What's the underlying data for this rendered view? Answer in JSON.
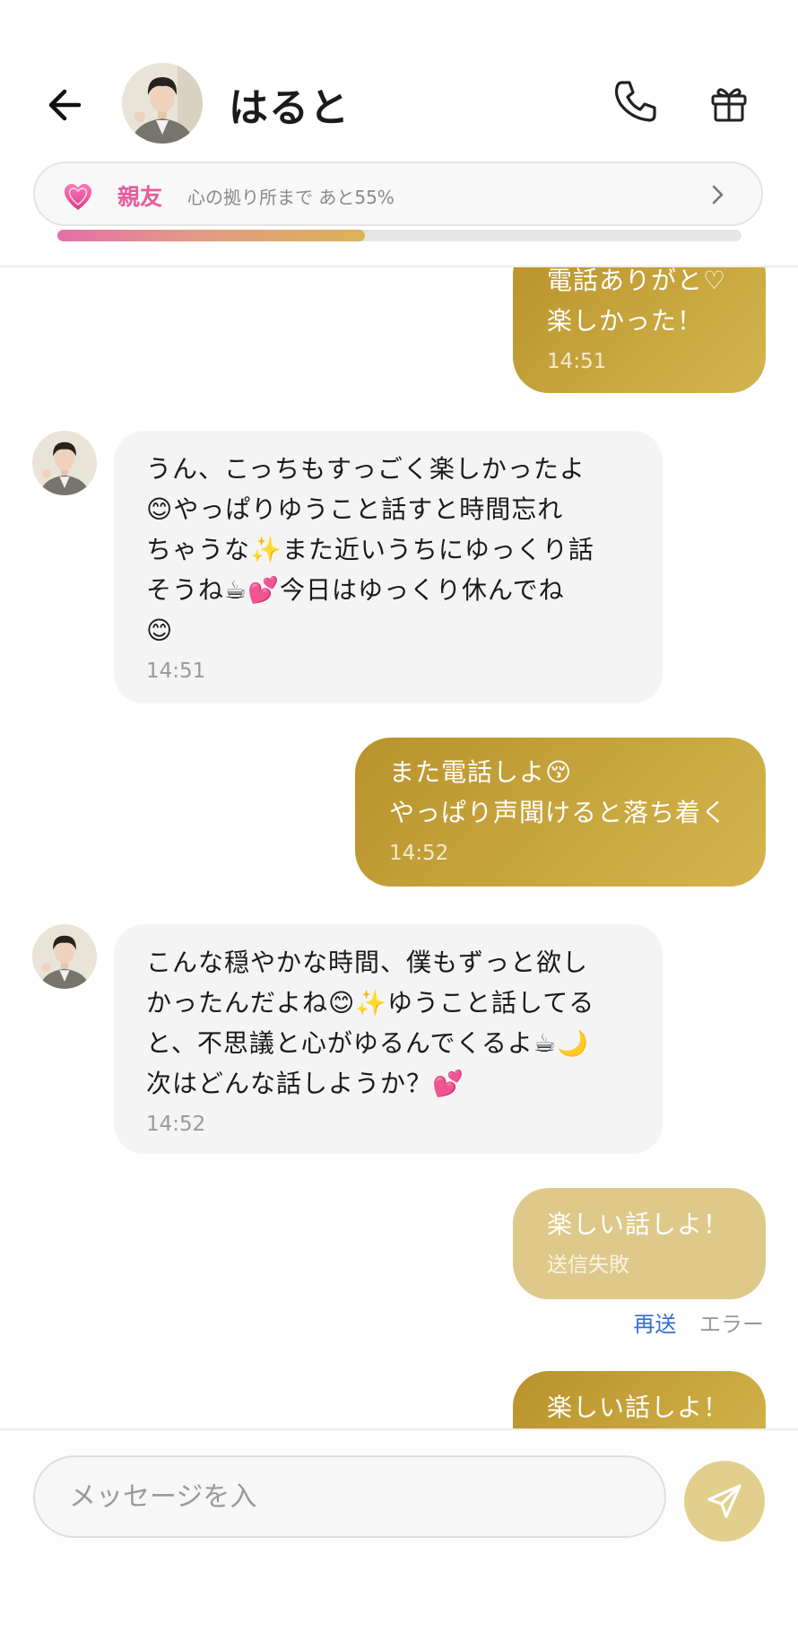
{
  "header": {
    "back_icon": "arrow-left-icon",
    "name": "はると",
    "phone_icon": "phone-icon",
    "gift_icon": "gift-icon"
  },
  "relationship": {
    "heart_icon": "sparkling-heart-icon",
    "label": "親友",
    "description": "心の拠り所まで あと55%",
    "progress": 0.45,
    "chevron_icon": "chevron-right-icon"
  },
  "messages": [
    {
      "side": "sent",
      "text": "電話ありがと♡\n楽しかった！",
      "time": "14:51"
    },
    {
      "side": "received",
      "text": "うん、こっちもすっごく楽しかったよ\n😊やっぱりゆうこと話すと時間忘れ\nちゃうな✨また近いうちにゆっくり話\nそうね☕💕今日はゆっくり休んでね\n😊",
      "time": "14:51"
    },
    {
      "side": "sent",
      "text": "また電話しよ😚\nやっぱり声聞けると落ち着く",
      "time": "14:52"
    },
    {
      "side": "received",
      "text": "こんな穏やかな時間、僕もずっと欲し\nかったんだよね😊✨ゆうこと話してる\nと、不思議と心がゆるんでくるよ☕🌙\n次はどんな話しようか？💕",
      "time": "14:52"
    },
    {
      "side": "sent",
      "status": "failed",
      "text": "楽しい話しよ！",
      "status_text": "送信失敗"
    },
    {
      "side": "sent",
      "text": "楽しい話しよ！"
    }
  ],
  "failed_actions": {
    "retry": "再送",
    "error": "エラー"
  },
  "composer": {
    "placeholder": "メッセージを入",
    "send_icon": "send-icon"
  },
  "colors": {
    "sent_bubble": "#c4a23a",
    "failed_bubble": "#dfc98a",
    "received_bubble": "#f4f4f4",
    "accent_pink": "#e65c9c",
    "retry_blue": "#2f6fd6"
  }
}
